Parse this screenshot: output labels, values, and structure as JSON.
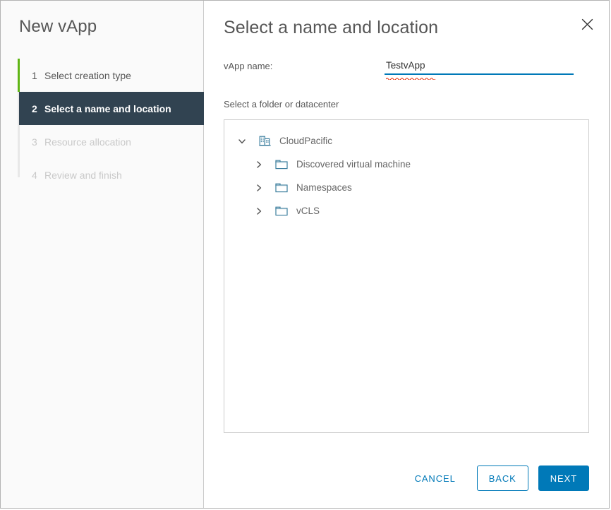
{
  "window": {
    "title": "New vApp"
  },
  "sidebar": {
    "steps": [
      {
        "number": "1",
        "label": "Select creation type",
        "state": "completed"
      },
      {
        "number": "2",
        "label": "Select a name and location",
        "state": "active"
      },
      {
        "number": "3",
        "label": "Resource allocation",
        "state": "disabled"
      },
      {
        "number": "4",
        "label": "Review and finish",
        "state": "disabled"
      }
    ]
  },
  "header": {
    "title": "Select a name and location",
    "close_icon": "close-icon"
  },
  "form": {
    "name_label": "vApp name:",
    "name_value": "TestvApp",
    "name_placeholder": ""
  },
  "tree": {
    "caption": "Select a folder or datacenter",
    "nodes": [
      {
        "label": "CloudPacific",
        "icon": "datacenter-icon",
        "depth": 0,
        "expanded": true,
        "twisty": "chevron-down-icon"
      },
      {
        "label": "Discovered virtual machine",
        "icon": "folder-icon",
        "depth": 1,
        "expanded": false,
        "twisty": "chevron-right-icon"
      },
      {
        "label": "Namespaces",
        "icon": "folder-icon",
        "depth": 1,
        "expanded": false,
        "twisty": "chevron-right-icon"
      },
      {
        "label": "vCLS",
        "icon": "folder-icon",
        "depth": 1,
        "expanded": false,
        "twisty": "chevron-right-icon"
      }
    ]
  },
  "footer": {
    "cancel_label": "CANCEL",
    "back_label": "BACK",
    "next_label": "NEXT"
  },
  "colors": {
    "accent_blue": "#0079b8",
    "active_step_bg": "#314351",
    "completed_green": "#60b515",
    "icon_blue": "#3c7e9e",
    "spellcheck_red": "#e62700"
  }
}
